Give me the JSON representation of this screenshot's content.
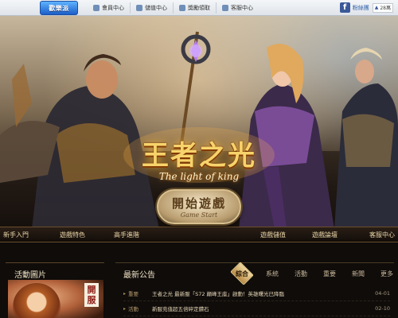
{
  "topbar": {
    "logo_text": "歡樂派",
    "nav": [
      {
        "label": "會員中心",
        "icon": "user-icon"
      },
      {
        "label": "儲值中心",
        "icon": "cart-icon"
      },
      {
        "label": "獎勵領取",
        "icon": "gift-icon"
      },
      {
        "label": "客服中心",
        "icon": "chat-icon"
      }
    ],
    "fb_label": "粉絲團",
    "like_count": "28萬",
    "colors": {
      "logo": "#1b5fc9",
      "facebook": "#3b5998"
    }
  },
  "hero": {
    "title_cn": "王者之光",
    "title_en": "The light of king",
    "start_cn": "開始遊戲",
    "start_en": "Game Start"
  },
  "mainnav": {
    "items": [
      "新手入門",
      "遊戲特色",
      "高手進階",
      "遊戲儲值",
      "遊戲論壇",
      "客服中心"
    ]
  },
  "events": {
    "title": "活動圖片",
    "badge": "開服"
  },
  "news": {
    "title": "最新公告",
    "tabs": [
      "綜合",
      "系統",
      "活動",
      "重要",
      "新聞",
      "更多"
    ],
    "items": [
      {
        "cat": "重要",
        "title": "王者之光 最新服「S72 巔峰王座」啟動！英雄曙光已降臨",
        "date": "04-01"
      },
      {
        "cat": "活動",
        "title": "新服充值超五倍碎定鑽石",
        "date": "02-10"
      }
    ]
  }
}
